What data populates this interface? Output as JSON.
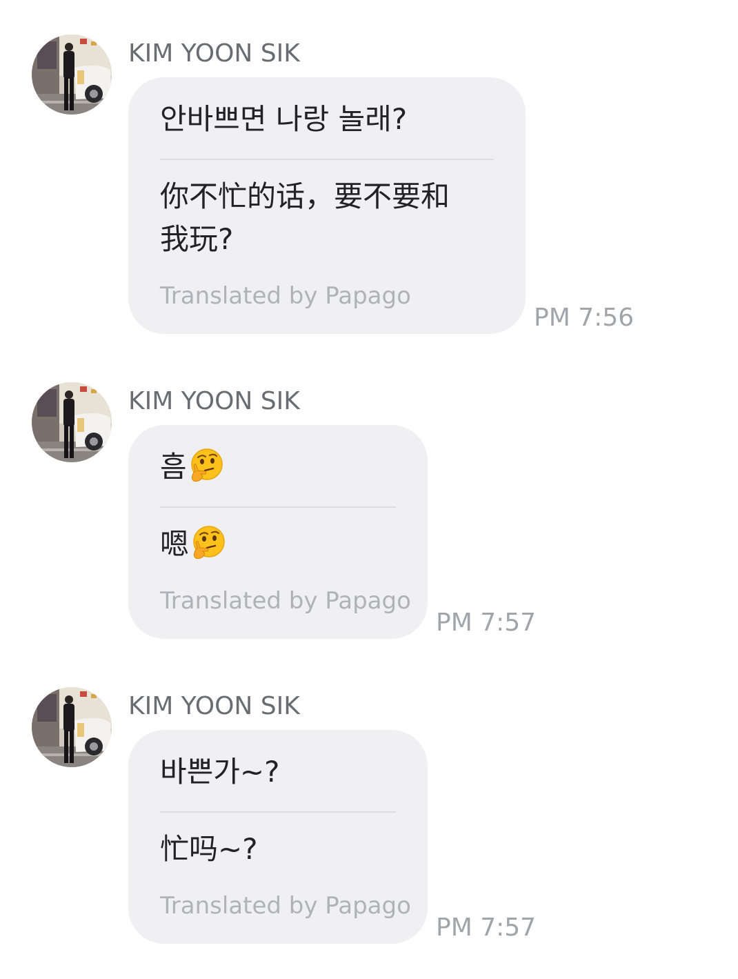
{
  "messages": [
    {
      "sender": "KIM YOON SIK",
      "original": "안바쁘면 나랑 놀래?",
      "translation_line1": "你不忙的话，要不要和",
      "translation_line2": "我玩?",
      "translated_by": "Translated by Papago",
      "time": "PM 7:56"
    },
    {
      "sender": "KIM YOON SIK",
      "original": "흠",
      "original_emoji": "thinking-face-icon",
      "translation": "嗯",
      "translation_emoji": "thinking-face-icon",
      "translated_by": "Translated by Papago",
      "time": "PM 7:57"
    },
    {
      "sender": "KIM YOON SIK",
      "original": "바쁜가~?",
      "translation": "忙吗~?",
      "translated_by": "Translated by Papago",
      "time": "PM 7:57"
    }
  ],
  "colors": {
    "bubble": "#f0f0f3",
    "sender": "#6b6c72",
    "text": "#222226",
    "muted": "#b1b2b8",
    "time": "#a3a4aa"
  }
}
